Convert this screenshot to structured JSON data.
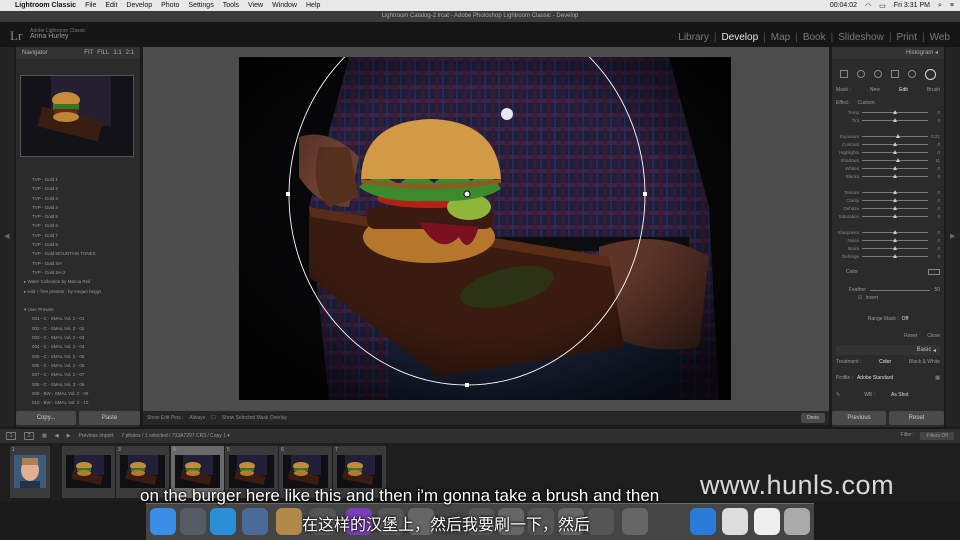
{
  "menubar": {
    "app_name": "Lightroom Classic",
    "items": [
      "File",
      "Edit",
      "Develop",
      "Photo",
      "Settings",
      "Tools",
      "View",
      "Window",
      "Help"
    ],
    "battery_time": "00:04:02",
    "clock": "Fri 3:31 PM"
  },
  "window": {
    "title": "Lightroom Catalog-2.lrcat - Adobe Photoshop Lightroom Classic - Develop"
  },
  "identity": {
    "logo": "Lr",
    "product": "Adobe Lightroom Classic",
    "user": "Anna Hurley",
    "modules": [
      "Library",
      "Develop",
      "Map",
      "Book",
      "Slideshow",
      "Print",
      "Web"
    ],
    "active_module": "Develop"
  },
  "left_panel": {
    "navigator_label": "Navigator",
    "zoom_options": [
      "FIT",
      "FILL",
      "1:1",
      "2:1"
    ],
    "presets": [
      {
        "label": "TVP - Gold 1",
        "group": false
      },
      {
        "label": "TVP - Gold 2",
        "group": false
      },
      {
        "label": "TVP - Gold 3",
        "group": false
      },
      {
        "label": "TVP - Gold 4",
        "group": false
      },
      {
        "label": "TVP - Gold 5",
        "group": false
      },
      {
        "label": "TVP - Gold 6",
        "group": false
      },
      {
        "label": "TVP - Gold 7",
        "group": false
      },
      {
        "label": "TVP - Gold 8",
        "group": false
      },
      {
        "label": "TVP - Gold MOUNTAIN TONES",
        "group": false
      },
      {
        "label": "TVP - Gold SH",
        "group": false
      },
      {
        "label": "TVP - Gold SH 2",
        "group": false
      },
      {
        "label": "▸ Water Collection by Marcia Reif",
        "group": true
      },
      {
        "label": "▸ wild + free presets - by megan beggs",
        "group": true
      },
      {
        "label": "",
        "group": true
      },
      {
        "label": "▾ User Presets",
        "group": true
      },
      {
        "label": "001 - C - SMAL Vol. 2 - 01",
        "group": false
      },
      {
        "label": "002 - C - SMAL Vol. 2 - 02",
        "group": false
      },
      {
        "label": "003 - C - SMAL Vol. 2 - 03",
        "group": false
      },
      {
        "label": "004 - C - SMAL Vol. 2 - 04",
        "group": false
      },
      {
        "label": "005 - C - SMAL Vol. 2 - 05",
        "group": false
      },
      {
        "label": "006 - C - SMAL Vol. 2 - 06",
        "group": false
      },
      {
        "label": "007 - C - SMAL Vol. 2 - 07",
        "group": false
      },
      {
        "label": "008 - C - SMAL Vol. 2 - 08",
        "group": false
      },
      {
        "label": "009 - BW - SMAL Vol. 2 - 09",
        "group": false
      },
      {
        "label": "010 - BW - SMAL Vol. 2 - 10",
        "group": false
      }
    ],
    "copy_label": "Copy...",
    "paste_label": "Paste"
  },
  "toolbar": {
    "show_edit_pins_label": "Show Edit Pins :",
    "show_edit_pins_value": "Always",
    "overlay_label": "Show Selected Mask Overlay",
    "done_label": "Done"
  },
  "right_panel": {
    "histogram_label": "Histogram",
    "mask_label": "Mask :",
    "new_label": "New",
    "edit_label": "Edit",
    "brush_label": "Brush",
    "effect_label": "Effect :",
    "effect_value": "Custom",
    "sliders": [
      {
        "name": "Temp",
        "value": "0",
        "pos": 0.5
      },
      {
        "name": "Tint",
        "value": "0",
        "pos": 0.5
      },
      {
        "name": "Exposure",
        "value": "0.21",
        "pos": 0.56
      },
      {
        "name": "Contrast",
        "value": "0",
        "pos": 0.5
      },
      {
        "name": "Highlights",
        "value": "0",
        "pos": 0.5
      },
      {
        "name": "Shadows",
        "value": "11",
        "pos": 0.56
      },
      {
        "name": "Whites",
        "value": "0",
        "pos": 0.5
      },
      {
        "name": "Blacks",
        "value": "0",
        "pos": 0.5
      },
      {
        "name": "Texture",
        "value": "0",
        "pos": 0.5
      },
      {
        "name": "Clarity",
        "value": "0",
        "pos": 0.5
      },
      {
        "name": "Dehaze",
        "value": "0",
        "pos": 0.5
      },
      {
        "name": "Saturation",
        "value": "0",
        "pos": 0.5
      },
      {
        "name": "Sharpness",
        "value": "0",
        "pos": 0.5
      },
      {
        "name": "Noise",
        "value": "0",
        "pos": 0.5
      },
      {
        "name": "Moiré",
        "value": "0",
        "pos": 0.5
      },
      {
        "name": "Defringe",
        "value": "0",
        "pos": 0.5
      }
    ],
    "color_label": "Color",
    "feather_label": "Feather",
    "feather_value": "50",
    "invert_label": "Invert",
    "range_mask_label": "Range Mask :",
    "range_mask_value": "Off",
    "reset_label": "Reset",
    "close_label": "Close",
    "basic_label": "Basic",
    "treatment_label": "Treatment :",
    "treatment_color": "Color",
    "treatment_bw": "Black & White",
    "profile_label": "Profile :",
    "profile_value": "Adobe Standard",
    "wb_label": "WB :",
    "wb_value": "As Shot",
    "previous_label": "Previous",
    "reset_button_label": "Reset"
  },
  "filmstrip_bar": {
    "page1": "1",
    "page2": "2",
    "previous_import": "Previous Import",
    "info": "7 photos / 1 selected / 733A7297.CR3 / Copy 1 ▾",
    "filter_label": "Filter :",
    "filter_value": "Filters Off"
  },
  "filmstrip": {
    "cells": [
      {
        "num": "1",
        "selected": false,
        "kind": "portrait"
      },
      {
        "num": "",
        "selected": false,
        "kind": "burger"
      },
      {
        "num": "3",
        "selected": false,
        "kind": "burger"
      },
      {
        "num": "4",
        "selected": true,
        "kind": "burger"
      },
      {
        "num": "5",
        "selected": false,
        "kind": "burger"
      },
      {
        "num": "6",
        "selected": false,
        "kind": "burger"
      },
      {
        "num": "7",
        "selected": false,
        "kind": "burger"
      }
    ]
  },
  "overlay": {
    "watermark": "www.hunls.com",
    "subtitle_en": "on the burger here like this and then i'm gonna take a brush and then",
    "subtitle_cn": "在这样的汉堡上，然后我要刷一下，然后"
  },
  "dock": {
    "icons": [
      "finder-icon",
      "launchpad-icon",
      "safari-icon",
      "preview-icon",
      "notes-icon",
      "app-icon",
      "app-icon",
      "app-icon",
      "app-icon",
      "app-icon",
      "app-icon",
      "app-icon",
      "app-icon",
      "app-icon",
      "app-icon",
      "app-icon",
      "folder-icon",
      "document-icon",
      "mail-icon",
      "trash-icon"
    ]
  }
}
